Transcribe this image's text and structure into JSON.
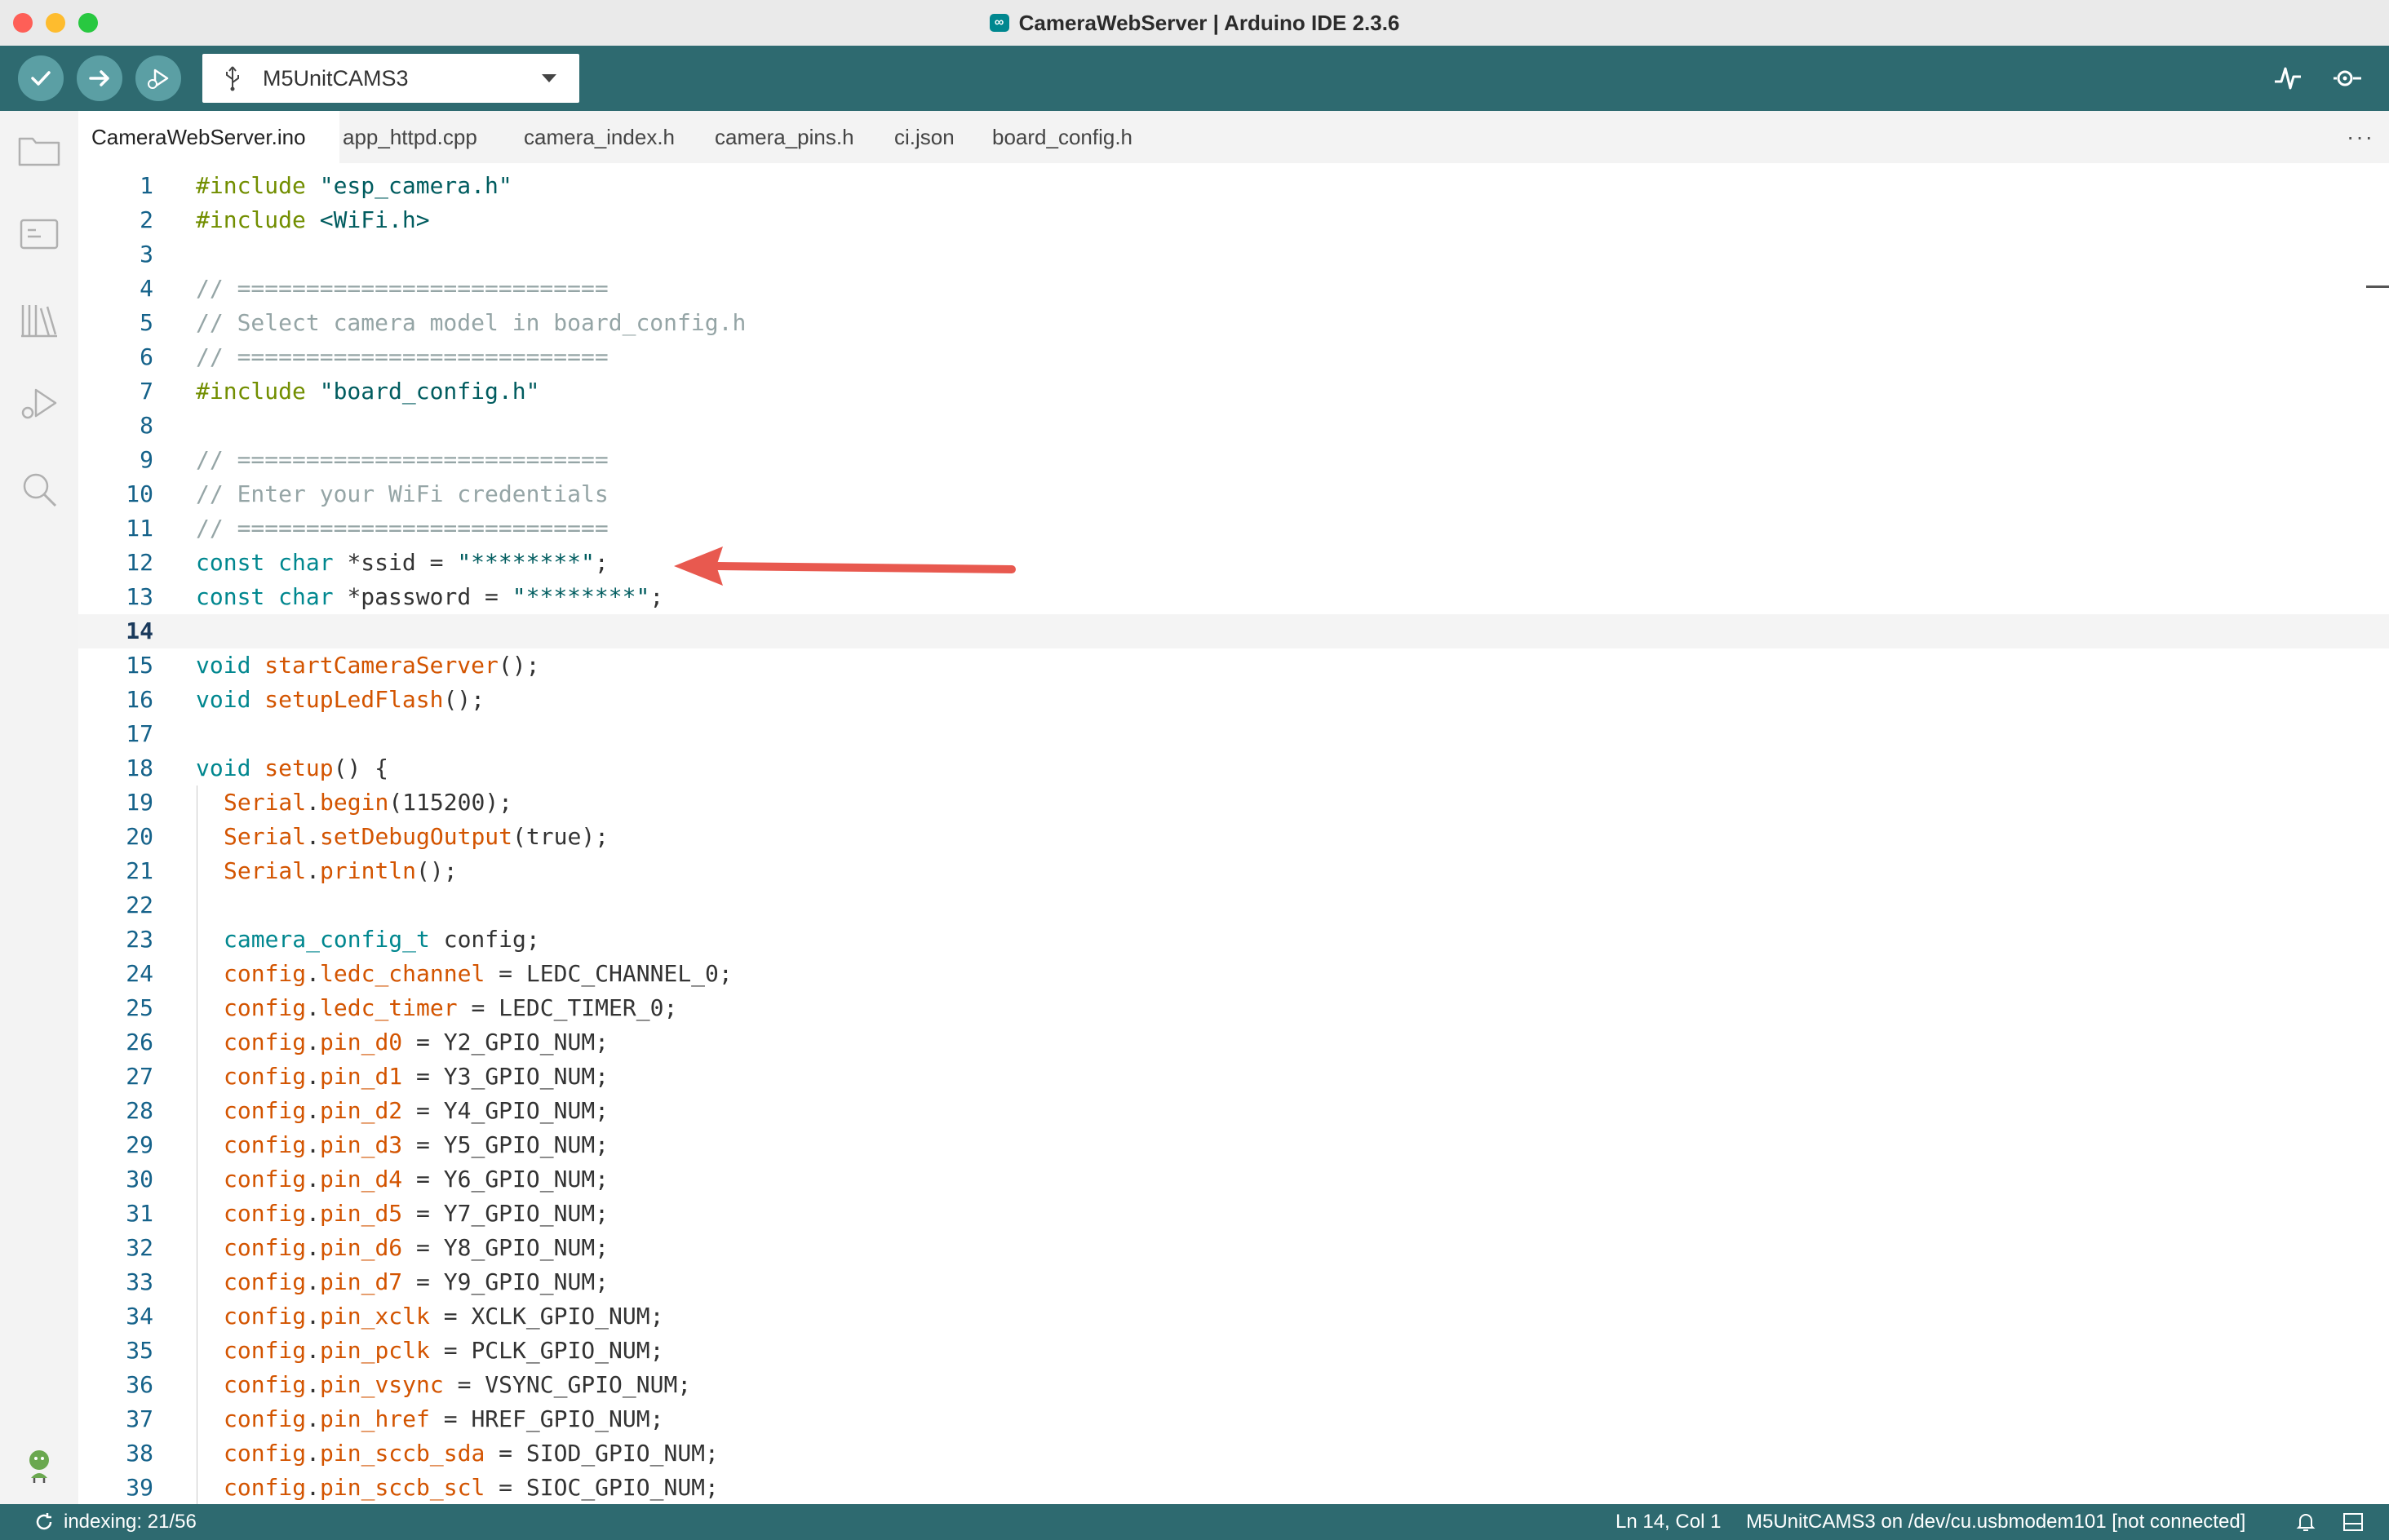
{
  "window": {
    "title": "CameraWebServer | Arduino IDE 2.3.6",
    "app_icon": "∞"
  },
  "toolbar": {
    "verify": "check-icon",
    "upload": "arrow-right-icon",
    "debug": "debug-icon",
    "board": "M5UnitCAMS3",
    "serial_plotter": "serial-plotter-icon",
    "serial_monitor": "serial-monitor-icon"
  },
  "sidebar": [
    "folder-icon",
    "board-manager-icon",
    "library-icon",
    "debug-icon",
    "search-icon",
    "profile-icon"
  ],
  "tabs": [
    {
      "label": "CameraWebServer.ino",
      "active": true
    },
    {
      "label": "app_httpd.cpp"
    },
    {
      "label": "camera_index.h"
    },
    {
      "label": "camera_pins.h"
    },
    {
      "label": "ci.json"
    },
    {
      "label": "board_config.h"
    }
  ],
  "tabs_more": "···",
  "editor": {
    "current_line": 14,
    "lines": [
      {
        "n": "1",
        "tokens": [
          [
            "pp",
            "#include "
          ],
          [
            "str",
            "\"esp_camera.h\""
          ]
        ]
      },
      {
        "n": "2",
        "tokens": [
          [
            "pp",
            "#include "
          ],
          [
            "str",
            "<WiFi.h>"
          ]
        ]
      },
      {
        "n": "3",
        "tokens": []
      },
      {
        "n": "4",
        "tokens": [
          [
            "cm",
            "// ==========================="
          ]
        ]
      },
      {
        "n": "5",
        "tokens": [
          [
            "cm",
            "// Select camera model in board_config.h"
          ]
        ]
      },
      {
        "n": "6",
        "tokens": [
          [
            "cm",
            "// ==========================="
          ]
        ]
      },
      {
        "n": "7",
        "tokens": [
          [
            "pp",
            "#include "
          ],
          [
            "str",
            "\"board_config.h\""
          ]
        ]
      },
      {
        "n": "8",
        "tokens": []
      },
      {
        "n": "9",
        "tokens": [
          [
            "cm",
            "// ==========================="
          ]
        ]
      },
      {
        "n": "10",
        "tokens": [
          [
            "cm",
            "// Enter your WiFi credentials"
          ]
        ]
      },
      {
        "n": "11",
        "tokens": [
          [
            "cm",
            "// ==========================="
          ]
        ]
      },
      {
        "n": "12",
        "tokens": [
          [
            "kw",
            "const "
          ],
          [
            "kw",
            "char "
          ],
          [
            "id",
            "*ssid = "
          ],
          [
            "str",
            "\"********\""
          ],
          [
            "id",
            ";"
          ]
        ]
      },
      {
        "n": "13",
        "tokens": [
          [
            "kw",
            "const "
          ],
          [
            "kw",
            "char "
          ],
          [
            "id",
            "*password = "
          ],
          [
            "str",
            "\"********\""
          ],
          [
            "id",
            ";"
          ]
        ]
      },
      {
        "n": "14",
        "tokens": []
      },
      {
        "n": "15",
        "tokens": [
          [
            "kw",
            "void "
          ],
          [
            "fn",
            "startCameraServer"
          ],
          [
            "id",
            "();"
          ]
        ]
      },
      {
        "n": "16",
        "tokens": [
          [
            "kw",
            "void "
          ],
          [
            "fn",
            "setupLedFlash"
          ],
          [
            "id",
            "();"
          ]
        ]
      },
      {
        "n": "17",
        "tokens": []
      },
      {
        "n": "18",
        "tokens": [
          [
            "kw",
            "void "
          ],
          [
            "fn",
            "setup"
          ],
          [
            "id",
            "() {"
          ]
        ]
      },
      {
        "n": "19",
        "indent": 1,
        "tokens": [
          [
            "fn",
            "Serial"
          ],
          [
            "id",
            "."
          ],
          [
            "fn",
            "begin"
          ],
          [
            "id",
            "(115200);"
          ]
        ]
      },
      {
        "n": "20",
        "indent": 1,
        "tokens": [
          [
            "fn",
            "Serial"
          ],
          [
            "id",
            "."
          ],
          [
            "fn",
            "setDebugOutput"
          ],
          [
            "id",
            "(true);"
          ]
        ]
      },
      {
        "n": "21",
        "indent": 1,
        "tokens": [
          [
            "fn",
            "Serial"
          ],
          [
            "id",
            "."
          ],
          [
            "fn",
            "println"
          ],
          [
            "id",
            "();"
          ]
        ]
      },
      {
        "n": "22",
        "indent": 1,
        "tokens": []
      },
      {
        "n": "23",
        "indent": 1,
        "tokens": [
          [
            "kw",
            "camera_config_t "
          ],
          [
            "id",
            "config;"
          ]
        ]
      },
      {
        "n": "24",
        "indent": 1,
        "tokens": [
          [
            "fn",
            "config"
          ],
          [
            "id",
            "."
          ],
          [
            "fn",
            "ledc_channel"
          ],
          [
            "id",
            " = LEDC_CHANNEL_0;"
          ]
        ]
      },
      {
        "n": "25",
        "indent": 1,
        "tokens": [
          [
            "fn",
            "config"
          ],
          [
            "id",
            "."
          ],
          [
            "fn",
            "ledc_timer"
          ],
          [
            "id",
            " = LEDC_TIMER_0;"
          ]
        ]
      },
      {
        "n": "26",
        "indent": 1,
        "tokens": [
          [
            "fn",
            "config"
          ],
          [
            "id",
            "."
          ],
          [
            "fn",
            "pin_d0"
          ],
          [
            "id",
            " = Y2_GPIO_NUM;"
          ]
        ]
      },
      {
        "n": "27",
        "indent": 1,
        "tokens": [
          [
            "fn",
            "config"
          ],
          [
            "id",
            "."
          ],
          [
            "fn",
            "pin_d1"
          ],
          [
            "id",
            " = Y3_GPIO_NUM;"
          ]
        ]
      },
      {
        "n": "28",
        "indent": 1,
        "tokens": [
          [
            "fn",
            "config"
          ],
          [
            "id",
            "."
          ],
          [
            "fn",
            "pin_d2"
          ],
          [
            "id",
            " = Y4_GPIO_NUM;"
          ]
        ]
      },
      {
        "n": "29",
        "indent": 1,
        "tokens": [
          [
            "fn",
            "config"
          ],
          [
            "id",
            "."
          ],
          [
            "fn",
            "pin_d3"
          ],
          [
            "id",
            " = Y5_GPIO_NUM;"
          ]
        ]
      },
      {
        "n": "30",
        "indent": 1,
        "tokens": [
          [
            "fn",
            "config"
          ],
          [
            "id",
            "."
          ],
          [
            "fn",
            "pin_d4"
          ],
          [
            "id",
            " = Y6_GPIO_NUM;"
          ]
        ]
      },
      {
        "n": "31",
        "indent": 1,
        "tokens": [
          [
            "fn",
            "config"
          ],
          [
            "id",
            "."
          ],
          [
            "fn",
            "pin_d5"
          ],
          [
            "id",
            " = Y7_GPIO_NUM;"
          ]
        ]
      },
      {
        "n": "32",
        "indent": 1,
        "tokens": [
          [
            "fn",
            "config"
          ],
          [
            "id",
            "."
          ],
          [
            "fn",
            "pin_d6"
          ],
          [
            "id",
            " = Y8_GPIO_NUM;"
          ]
        ]
      },
      {
        "n": "33",
        "indent": 1,
        "tokens": [
          [
            "fn",
            "config"
          ],
          [
            "id",
            "."
          ],
          [
            "fn",
            "pin_d7"
          ],
          [
            "id",
            " = Y9_GPIO_NUM;"
          ]
        ]
      },
      {
        "n": "34",
        "indent": 1,
        "tokens": [
          [
            "fn",
            "config"
          ],
          [
            "id",
            "."
          ],
          [
            "fn",
            "pin_xclk"
          ],
          [
            "id",
            " = XCLK_GPIO_NUM;"
          ]
        ]
      },
      {
        "n": "35",
        "indent": 1,
        "tokens": [
          [
            "fn",
            "config"
          ],
          [
            "id",
            "."
          ],
          [
            "fn",
            "pin_pclk"
          ],
          [
            "id",
            " = PCLK_GPIO_NUM;"
          ]
        ]
      },
      {
        "n": "36",
        "indent": 1,
        "tokens": [
          [
            "fn",
            "config"
          ],
          [
            "id",
            "."
          ],
          [
            "fn",
            "pin_vsync"
          ],
          [
            "id",
            " = VSYNC_GPIO_NUM;"
          ]
        ]
      },
      {
        "n": "37",
        "indent": 1,
        "tokens": [
          [
            "fn",
            "config"
          ],
          [
            "id",
            "."
          ],
          [
            "fn",
            "pin_href"
          ],
          [
            "id",
            " = HREF_GPIO_NUM;"
          ]
        ]
      },
      {
        "n": "38",
        "indent": 1,
        "tokens": [
          [
            "fn",
            "config"
          ],
          [
            "id",
            "."
          ],
          [
            "fn",
            "pin_sccb_sda"
          ],
          [
            "id",
            " = SIOD_GPIO_NUM;"
          ]
        ]
      },
      {
        "n": "39",
        "indent": 1,
        "tokens": [
          [
            "fn",
            "config"
          ],
          [
            "id",
            "."
          ],
          [
            "fn",
            "pin_sccb_scl"
          ],
          [
            "id",
            " = SIOC_GPIO_NUM;"
          ]
        ]
      }
    ]
  },
  "annotation": {
    "arrow_color": "#e8594f",
    "points_to_lines": [
      "12",
      "13"
    ]
  },
  "status": {
    "indexing": "indexing: 21/56",
    "cursor": "Ln 14, Col 1",
    "connection": "M5UnitCAMS3 on /dev/cu.usbmodem101 [not connected]"
  },
  "colors": {
    "teal_bar": "#2e6a70",
    "keyword": "#00878f",
    "preprocessor": "#728e00",
    "comment": "#95a5a6",
    "function": "#d35400",
    "string": "#005c5f"
  }
}
